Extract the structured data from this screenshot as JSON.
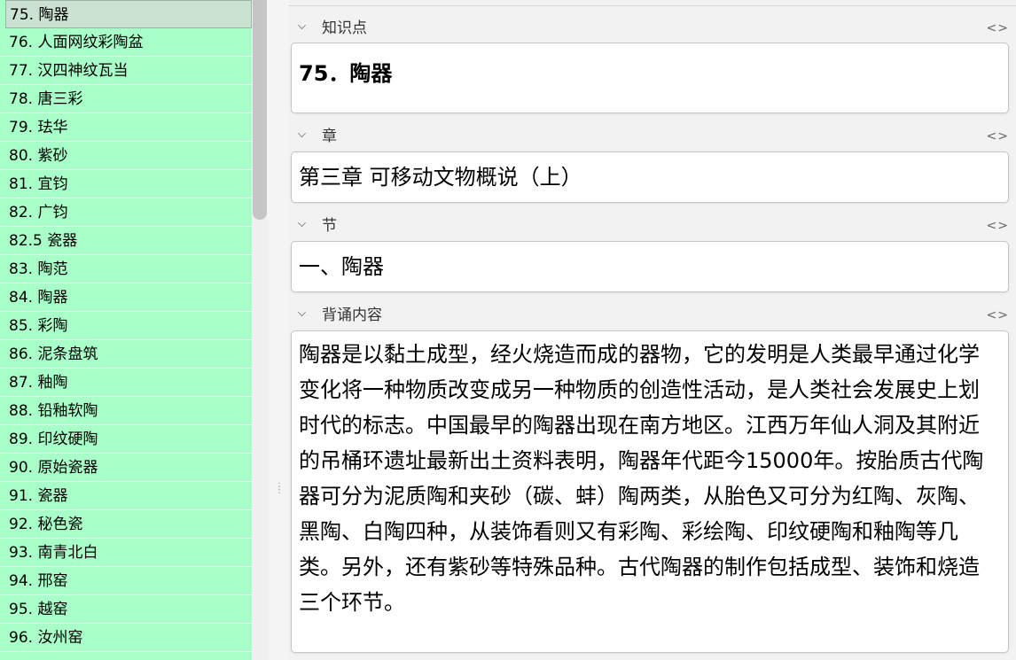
{
  "sidebar": {
    "items": [
      {
        "label": "75. 陶器",
        "selected": true
      },
      {
        "label": "76. 人面网纹彩陶盆"
      },
      {
        "label": "77. 汉四神纹瓦当"
      },
      {
        "label": "78. 唐三彩"
      },
      {
        "label": "79. 珐华"
      },
      {
        "label": "80. 紫砂"
      },
      {
        "label": "81. 宜钧"
      },
      {
        "label": "82. 广钧"
      },
      {
        "label": "82.5 瓷器"
      },
      {
        "label": "83. 陶范"
      },
      {
        "label": "84. 陶器"
      },
      {
        "label": "85. 彩陶"
      },
      {
        "label": "86. 泥条盘筑"
      },
      {
        "label": "87. 釉陶"
      },
      {
        "label": "88. 铅釉软陶"
      },
      {
        "label": "89. 印纹硬陶"
      },
      {
        "label": "90. 原始瓷器"
      },
      {
        "label": "91. 瓷器"
      },
      {
        "label": "92. 秘色瓷"
      },
      {
        "label": "93. 南青北白"
      },
      {
        "label": "94. 邢窑"
      },
      {
        "label": "95. 越窑"
      },
      {
        "label": "96. 汝州窑"
      }
    ]
  },
  "fields": {
    "knowledge": {
      "label": "知识点",
      "value": "75．陶器"
    },
    "chapter": {
      "label": "章",
      "value": "第三章 可移动文物概说（上）"
    },
    "section": {
      "label": "节",
      "value": "一、陶器"
    },
    "content": {
      "label": "背诵内容",
      "value": "陶器是以黏土成型，经火烧造而成的器物，它的发明是人类最早通过化学变化将一种物质改变成另一种物质的创造性活动，是人类社会发展史上划时代的标志。中国最早的陶器出现在南方地区。江西万年仙人洞及其附近的吊桶环遗址最新出土资料表明，陶器年代距今15000年。按胎质古代陶器可分为泥质陶和夹砂（碳、蚌）陶两类，从胎色又可分为红陶、灰陶、黑陶、白陶四种，从装饰看则又有彩陶、彩绘陶、印纹硬陶和釉陶等几类。另外，还有紫砂等特殊品种。古代陶器的制作包括成型、装饰和烧造三个环节。"
    }
  },
  "icons": {
    "collapse": "chevron-down-icon",
    "toggle": "code-toggle-icon"
  },
  "colors": {
    "list_bg": "#a8ffc8",
    "selected_bg": "#c9e2d2"
  }
}
